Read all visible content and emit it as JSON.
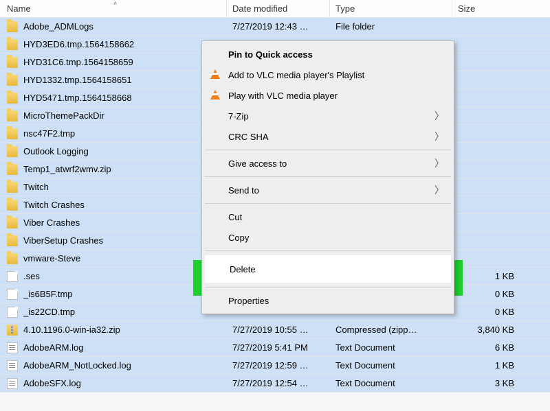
{
  "headers": {
    "name": "Name",
    "date": "Date modified",
    "type": "Type",
    "size": "Size"
  },
  "rows": [
    {
      "icon": "folder",
      "name": "Adobe_ADMLogs",
      "date": "7/27/2019 12:43 …",
      "type": "File folder",
      "size": ""
    },
    {
      "icon": "folder",
      "name": "HYD3ED6.tmp.1564158662",
      "date": "",
      "type": "",
      "size": ""
    },
    {
      "icon": "folder",
      "name": "HYD31C6.tmp.1564158659",
      "date": "",
      "type": "",
      "size": ""
    },
    {
      "icon": "folder",
      "name": "HYD1332.tmp.1564158651",
      "date": "",
      "type": "",
      "size": ""
    },
    {
      "icon": "folder",
      "name": "HYD5471.tmp.1564158668",
      "date": "",
      "type": "",
      "size": ""
    },
    {
      "icon": "folder",
      "name": "MicroThemePackDir",
      "date": "",
      "type": "",
      "size": ""
    },
    {
      "icon": "folder",
      "name": "nsc47F2.tmp",
      "date": "",
      "type": "",
      "size": ""
    },
    {
      "icon": "folder",
      "name": "Outlook Logging",
      "date": "",
      "type": "",
      "size": ""
    },
    {
      "icon": "folder",
      "name": "Temp1_atwrf2wmv.zip",
      "date": "",
      "type": "",
      "size": ""
    },
    {
      "icon": "folder",
      "name": "Twitch",
      "date": "",
      "type": "",
      "size": ""
    },
    {
      "icon": "folder",
      "name": "Twitch Crashes",
      "date": "",
      "type": "",
      "size": ""
    },
    {
      "icon": "folder",
      "name": "Viber Crashes",
      "date": "",
      "type": "",
      "size": ""
    },
    {
      "icon": "folder",
      "name": "ViberSetup Crashes",
      "date": "",
      "type": "",
      "size": ""
    },
    {
      "icon": "folder",
      "name": "vmware-Steve",
      "date": "",
      "type": "",
      "size": ""
    },
    {
      "icon": "file",
      "name": ".ses",
      "date": "",
      "type": "",
      "size": "1 KB"
    },
    {
      "icon": "file",
      "name": "_is6B5F.tmp",
      "date": "",
      "type": "",
      "size": "0 KB"
    },
    {
      "icon": "file",
      "name": "_is22CD.tmp",
      "date": "",
      "type": "",
      "size": "0 KB"
    },
    {
      "icon": "zip",
      "name": "4.10.1196.0-win-ia32.zip",
      "date": "7/27/2019 10:55 …",
      "type": "Compressed (zipp…",
      "size": "3,840 KB"
    },
    {
      "icon": "log",
      "name": "AdobeARM.log",
      "date": "7/27/2019 5:41 PM",
      "type": "Text Document",
      "size": "6 KB"
    },
    {
      "icon": "log",
      "name": "AdobeARM_NotLocked.log",
      "date": "7/27/2019 12:59 …",
      "type": "Text Document",
      "size": "1 KB"
    },
    {
      "icon": "log",
      "name": "AdobeSFX.log",
      "date": "7/27/2019 12:54 …",
      "type": "Text Document",
      "size": "3 KB"
    }
  ],
  "menu": {
    "pin": "Pin to Quick access",
    "vlc_add": "Add to VLC media player's Playlist",
    "vlc_play": "Play with VLC media player",
    "sevenzip": "7-Zip",
    "crc": "CRC SHA",
    "give": "Give access to",
    "sendto": "Send to",
    "cut": "Cut",
    "copy": "Copy",
    "delete": "Delete",
    "properties": "Properties"
  }
}
